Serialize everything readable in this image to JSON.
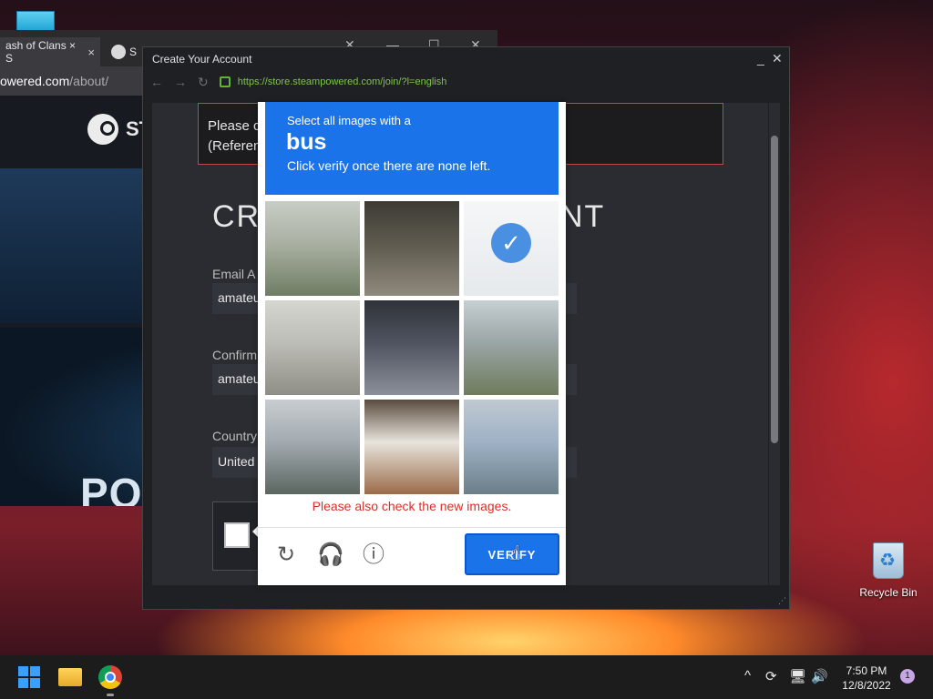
{
  "background_browser": {
    "tab1_label": "ash of Clans × S",
    "tab1_close": "×",
    "tab2_label": "S",
    "url_host": "owered.com",
    "url_path": "/about/",
    "logo_text": "ST",
    "hero_text": "PO"
  },
  "dialog": {
    "title": "Create Your Account",
    "minimize": "_",
    "close": "✕",
    "url": "https://store.steampowered.com/join/?l=english",
    "notice_line1": "Please c",
    "notice_line2": "(Referen",
    "heading_left": "CR",
    "heading_right": "NT",
    "email_label": "Email A",
    "email_value": "amateu",
    "confirm_label": "Confirm",
    "confirm_value": "amateu",
    "country_label": "Country",
    "country_value": "United"
  },
  "captcha": {
    "prompt_line1": "Select all images with a",
    "prompt_target": "bus",
    "prompt_line3": "Click verify once there are none left.",
    "error_text": "Please also check the new images.",
    "verify_label": "VERIFY",
    "reload_icon": "↻",
    "audio_icon": "🎧",
    "info_icon": "ⓘ",
    "check_mark": "✓",
    "tiles": [
      {
        "label": "road-with-trees",
        "selected": false,
        "colors": [
          "#a9b0a2",
          "#6f7d64",
          "#c8cdc6"
        ]
      },
      {
        "label": "pickup-truck",
        "selected": false,
        "colors": [
          "#5e5a4e",
          "#8f8a7c",
          "#3d3b35"
        ]
      },
      {
        "label": "selected-tile",
        "selected": true,
        "colors": [
          "#cfd6dc",
          "#b8c2c8",
          "#e2e6e8"
        ]
      },
      {
        "label": "highway",
        "selected": false,
        "colors": [
          "#bdbdb7",
          "#8e8d86",
          "#d6d6d1"
        ]
      },
      {
        "label": "bridge-car",
        "selected": false,
        "colors": [
          "#4f5460",
          "#8a8f99",
          "#2f3238"
        ]
      },
      {
        "label": "building-road",
        "selected": false,
        "colors": [
          "#9aa5a6",
          "#6e7c5c",
          "#c6cfd2"
        ]
      },
      {
        "label": "palm-tree",
        "selected": false,
        "colors": [
          "#a2aab0",
          "#5b6660",
          "#c8cdd0"
        ]
      },
      {
        "label": "bus-side",
        "selected": false,
        "colors": [
          "#e8e4dc",
          "#9a6b4a",
          "#5a4b3e"
        ]
      },
      {
        "label": "warehouse",
        "selected": false,
        "colors": [
          "#9fb1c6",
          "#6b7f88",
          "#bfc9d2"
        ]
      }
    ]
  },
  "desktop": {
    "recycle_bin_label": "Recycle Bin"
  },
  "taskbar": {
    "time": "7:50 PM",
    "date": "12/8/2022",
    "notification_count": "1",
    "tray_chevron": "^",
    "tray_sync": "⟳",
    "tray_network": "🖥",
    "tray_volume": "🔊"
  }
}
